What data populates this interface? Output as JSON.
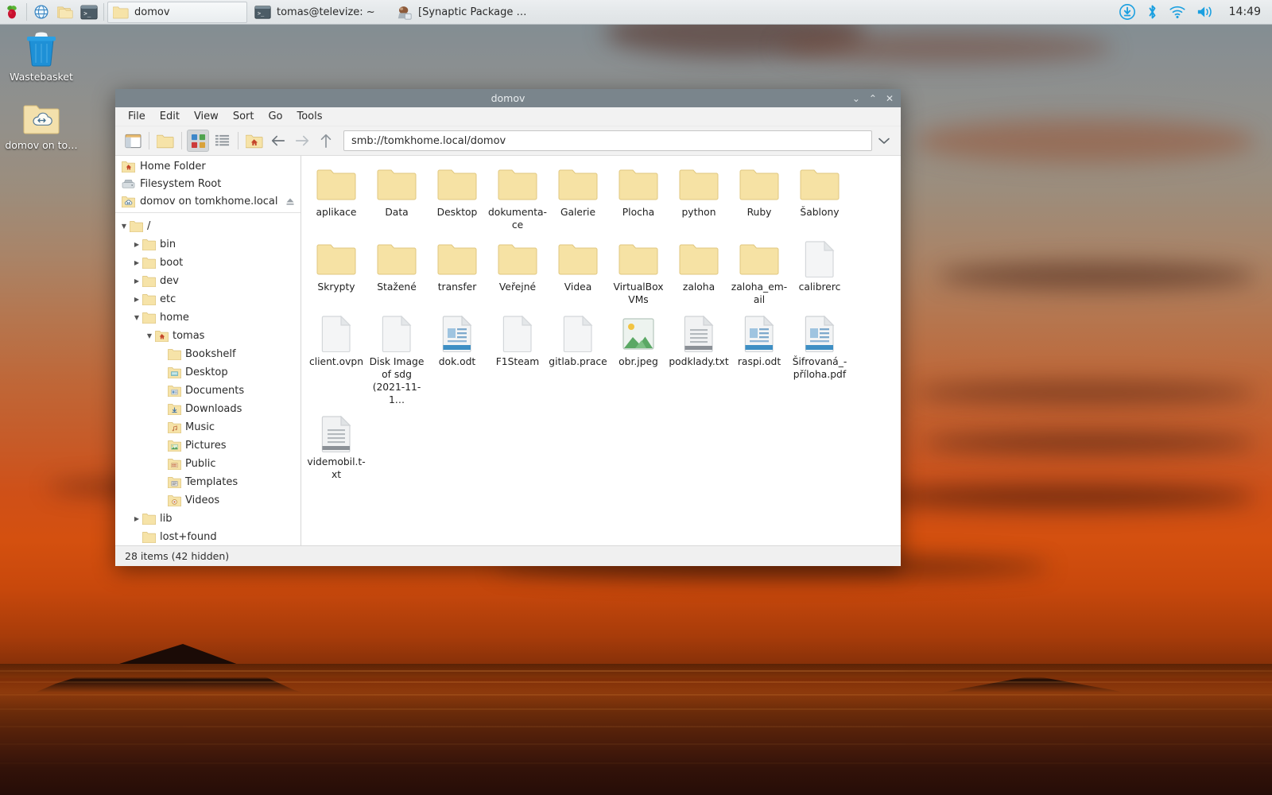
{
  "taskbar": {
    "launcher_icon": "raspberry-pi-icon",
    "quick_launch": [
      {
        "icon": "web-browser-icon",
        "name": "web-browser"
      },
      {
        "icon": "file-manager-icon",
        "name": "file-manager"
      },
      {
        "icon": "terminal-icon",
        "name": "terminal"
      }
    ],
    "windows": [
      {
        "label": "domov",
        "icon": "folder-icon",
        "active": true
      },
      {
        "label": "tomas@televize: ~",
        "icon": "terminal-icon",
        "active": false
      },
      {
        "label": "[Synaptic Package M…",
        "icon": "synaptic-icon",
        "active": false
      }
    ],
    "tray": [
      {
        "name": "updates-icon",
        "icon": "download-circle"
      },
      {
        "name": "bluetooth-icon",
        "icon": "bluetooth"
      },
      {
        "name": "wifi-icon",
        "icon": "wifi"
      },
      {
        "name": "volume-icon",
        "icon": "speaker"
      }
    ],
    "clock": "14:49",
    "accent": "#1a9fe0"
  },
  "desktop": {
    "icons": [
      {
        "label": "Wastebasket",
        "icon": "wastebasket-icon"
      },
      {
        "label": "domov on to…",
        "icon": "network-folder-icon"
      }
    ]
  },
  "window": {
    "title": "domov",
    "controls": {
      "minimize": "⌄",
      "maximize": "⌃",
      "close": "✕"
    },
    "menus": [
      "File",
      "Edit",
      "View",
      "Sort",
      "Go",
      "Tools"
    ],
    "toolbar": [
      {
        "name": "toggle-sidebar-button",
        "icon": "sidebar-icon",
        "pressed": false
      },
      {
        "name": "new-folder-button",
        "icon": "folder-icon",
        "pressed": false
      },
      {
        "name": "icon-view-button",
        "icon": "icon-view-icon",
        "pressed": true
      },
      {
        "name": "list-view-button",
        "icon": "list-view-icon",
        "pressed": false
      },
      {
        "name": "home-button",
        "icon": "home-folder-icon",
        "pressed": false
      },
      {
        "name": "back-button",
        "icon": "arrow-left-icon",
        "pressed": false
      },
      {
        "name": "forward-button",
        "icon": "arrow-right-icon",
        "pressed": false
      },
      {
        "name": "up-button",
        "icon": "arrow-up-icon",
        "pressed": false
      }
    ],
    "path": {
      "value": "smb://tomkhome.local/domov",
      "placeholder": "Location"
    },
    "statusbar": "28 items (42 hidden)"
  },
  "sidebar": {
    "places": [
      {
        "label": "Home Folder",
        "icon": "home-folder-icon"
      },
      {
        "label": "Filesystem Root",
        "icon": "drive-icon"
      },
      {
        "label": "domov on tomkhome.local",
        "icon": "network-folder-icon",
        "eject": true
      }
    ],
    "tree": [
      {
        "label": "/",
        "depth": 0,
        "arrow": "down",
        "icon": "folder-icon"
      },
      {
        "label": "bin",
        "depth": 1,
        "arrow": "right",
        "icon": "folder-icon"
      },
      {
        "label": "boot",
        "depth": 1,
        "arrow": "right",
        "icon": "folder-icon"
      },
      {
        "label": "dev",
        "depth": 1,
        "arrow": "right",
        "icon": "folder-icon"
      },
      {
        "label": "etc",
        "depth": 1,
        "arrow": "right",
        "icon": "folder-icon"
      },
      {
        "label": "home",
        "depth": 1,
        "arrow": "down",
        "icon": "folder-icon"
      },
      {
        "label": "tomas",
        "depth": 2,
        "arrow": "down",
        "icon": "home-folder-icon"
      },
      {
        "label": "Bookshelf",
        "depth": 3,
        "arrow": "none",
        "icon": "folder-icon"
      },
      {
        "label": "Desktop",
        "depth": 3,
        "arrow": "none",
        "icon": "desktop-folder-icon"
      },
      {
        "label": "Documents",
        "depth": 3,
        "arrow": "none",
        "icon": "documents-folder-icon"
      },
      {
        "label": "Downloads",
        "depth": 3,
        "arrow": "none",
        "icon": "downloads-folder-icon"
      },
      {
        "label": "Music",
        "depth": 3,
        "arrow": "none",
        "icon": "music-folder-icon"
      },
      {
        "label": "Pictures",
        "depth": 3,
        "arrow": "none",
        "icon": "pictures-folder-icon"
      },
      {
        "label": "Public",
        "depth": 3,
        "arrow": "none",
        "icon": "public-folder-icon"
      },
      {
        "label": "Templates",
        "depth": 3,
        "arrow": "none",
        "icon": "templates-folder-icon"
      },
      {
        "label": "Videos",
        "depth": 3,
        "arrow": "none",
        "icon": "videos-folder-icon"
      },
      {
        "label": "lib",
        "depth": 1,
        "arrow": "right",
        "icon": "folder-icon"
      },
      {
        "label": "lost+found",
        "depth": 1,
        "arrow": "none",
        "icon": "folder-icon"
      }
    ]
  },
  "files": [
    {
      "name": "aplikace",
      "type": "folder"
    },
    {
      "name": "Data",
      "type": "folder"
    },
    {
      "name": "Desktop",
      "type": "folder"
    },
    {
      "name": "dokumenta-ce",
      "type": "folder"
    },
    {
      "name": "Galerie",
      "type": "folder"
    },
    {
      "name": "Plocha",
      "type": "folder"
    },
    {
      "name": "python",
      "type": "folder"
    },
    {
      "name": "Ruby",
      "type": "folder"
    },
    {
      "name": "Šablony",
      "type": "folder"
    },
    {
      "name": "Skrypty",
      "type": "folder"
    },
    {
      "name": "Stažené",
      "type": "folder"
    },
    {
      "name": "transfer",
      "type": "folder"
    },
    {
      "name": "Veřejné",
      "type": "folder"
    },
    {
      "name": "Videa",
      "type": "folder"
    },
    {
      "name": "VirtualBox VMs",
      "type": "folder"
    },
    {
      "name": "zaloha",
      "type": "folder"
    },
    {
      "name": "zaloha_em-ail",
      "type": "folder"
    },
    {
      "name": "calibrerc",
      "type": "blank-file"
    },
    {
      "name": "client.ovpn",
      "type": "blank-file"
    },
    {
      "name": "Disk Image of sdg (2021-11-1…",
      "type": "blank-file"
    },
    {
      "name": "dok.odt",
      "type": "odt-file"
    },
    {
      "name": "F1Steam",
      "type": "blank-file"
    },
    {
      "name": "gitlab.prace",
      "type": "blank-file"
    },
    {
      "name": "obr.jpeg",
      "type": "image-file"
    },
    {
      "name": "podklady.txt",
      "type": "text-file"
    },
    {
      "name": "raspi.odt",
      "type": "odt-file"
    },
    {
      "name": "Šifrovaná_-příloha.pdf",
      "type": "odt-file"
    },
    {
      "name": "videmobil.t-xt",
      "type": "text-file"
    }
  ]
}
